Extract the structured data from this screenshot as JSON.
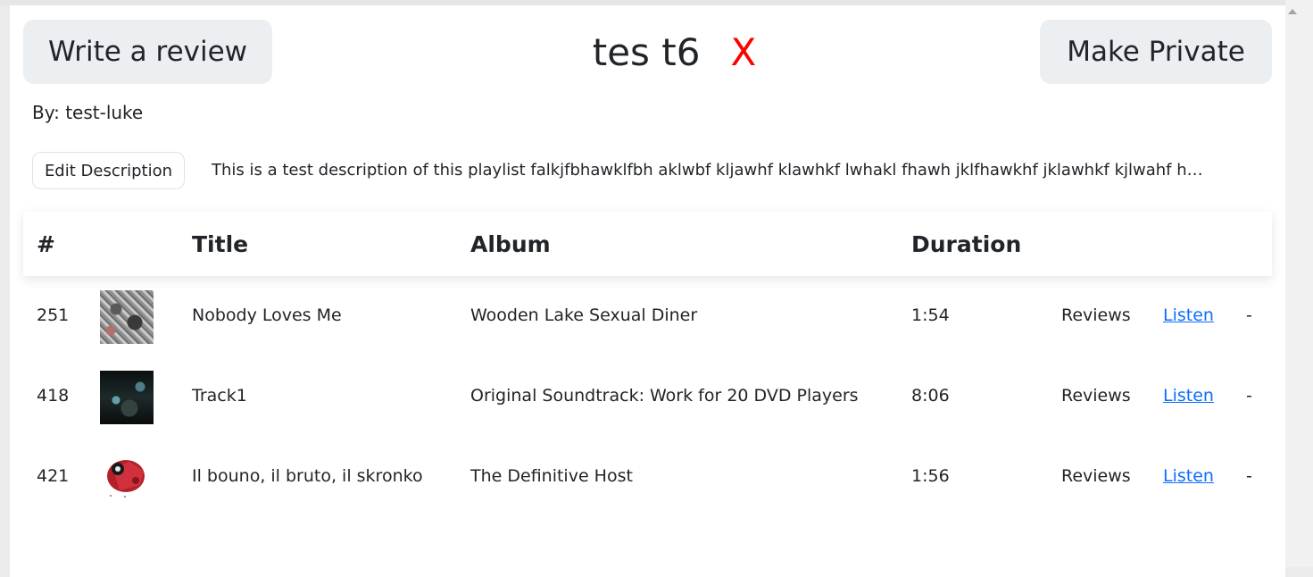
{
  "header": {
    "write_review_label": "Write a review",
    "playlist_name": "tes t6",
    "delete_label": "X",
    "make_private_label": "Make Private"
  },
  "byline": "By: test-luke",
  "edit_description_label": "Edit Description",
  "description": "This is a test description of this playlist falkjfbhawklfbh aklwbf kljawhf klawhkf lwhakl fhawh jklfhawkhf jklawhkf kjlwahf hwakl f...",
  "table": {
    "headers": {
      "number": "#",
      "title": "Title",
      "album": "Album",
      "duration": "Duration"
    },
    "rows": [
      {
        "number": "251",
        "title": "Nobody Loves Me",
        "album": "Wooden Lake Sexual Diner",
        "duration": "1:54",
        "reviews": "Reviews",
        "listen": "Listen",
        "remove": "-"
      },
      {
        "number": "418",
        "title": "Track1",
        "album": "Original Soundtrack: Work for 20 DVD Players",
        "duration": "8:06",
        "reviews": "Reviews",
        "listen": "Listen",
        "remove": "-"
      },
      {
        "number": "421",
        "title": "Il bouno, il bruto, il skronko",
        "album": "The Definitive Host",
        "duration": "1:56",
        "reviews": "Reviews",
        "listen": "Listen",
        "remove": "-"
      }
    ]
  },
  "colors": {
    "delete_x": "#ff0000",
    "link": "#0d6efd",
    "button_bg": "#eceff1"
  }
}
